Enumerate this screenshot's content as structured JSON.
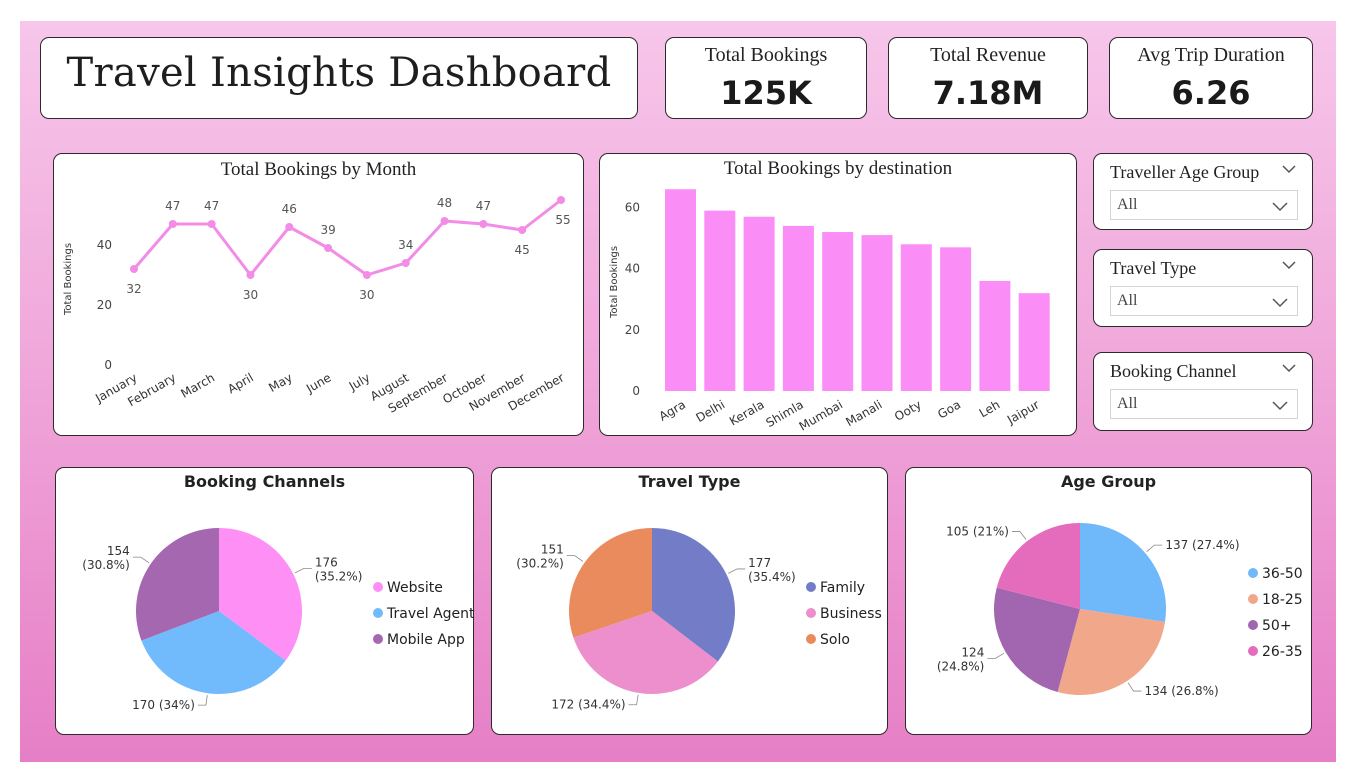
{
  "header": {
    "title": "Travel Insights Dashboard"
  },
  "kpis": [
    {
      "label": "Total Bookings",
      "value": "125K"
    },
    {
      "label": "Total Revenue",
      "value": "7.18M"
    },
    {
      "label": "Avg Trip Duration",
      "value": "6.26"
    }
  ],
  "slicers": [
    {
      "label": "Traveller Age Group",
      "value": "All"
    },
    {
      "label": "Travel Type",
      "value": "All"
    },
    {
      "label": "Booking Channel",
      "value": "All"
    }
  ],
  "chart_data": [
    {
      "type": "line",
      "title": "Total Bookings by Month",
      "ylabel": "Total Bookings",
      "xlabel": "",
      "categories": [
        "January",
        "February",
        "March",
        "April",
        "May",
        "June",
        "July",
        "August",
        "September",
        "October",
        "November",
        "December"
      ],
      "values": [
        32,
        47,
        47,
        30,
        46,
        39,
        30,
        34,
        48,
        47,
        45,
        55
      ],
      "y_ticks": [
        "0",
        "20",
        "40"
      ],
      "ylim": [
        0,
        60
      ],
      "color": "#f28ce6",
      "grid": false
    },
    {
      "type": "bar",
      "title": "Total Bookings by destination",
      "ylabel": "Total Bookings",
      "xlabel": "",
      "categories": [
        "Agra",
        "Delhi",
        "Kerala",
        "Shimla",
        "Mumbai",
        "Manali",
        "Ooty",
        "Goa",
        "Leh",
        "Jaipur"
      ],
      "values": [
        66,
        59,
        57,
        54,
        52,
        51,
        48,
        47,
        36,
        32
      ],
      "y_ticks": [
        "0",
        "20",
        "40",
        "60"
      ],
      "ylim": [
        0,
        70
      ],
      "color": "#fb8ef6",
      "grid": false
    },
    {
      "type": "pie",
      "title": "Booking Channels",
      "slices": [
        {
          "name": "Website",
          "value": 176,
          "label": "176",
          "pct": "(35.2%)",
          "color": "#fd8ff5"
        },
        {
          "name": "Travel Agent",
          "value": 170,
          "label": "170 (34%)",
          "pct": "",
          "color": "#71bbfd"
        },
        {
          "name": "Mobile App",
          "value": 154,
          "label": "154",
          "pct": "(30.8%)",
          "color": "#a667b1"
        }
      ],
      "legend": "right"
    },
    {
      "type": "pie",
      "title": "Travel Type",
      "slices": [
        {
          "name": "Family",
          "value": 177,
          "label": "177",
          "pct": "(35.4%)",
          "color": "#737cc6"
        },
        {
          "name": "Business",
          "value": 172,
          "label": "172 (34.4%)",
          "pct": "",
          "color": "#ec8fcc"
        },
        {
          "name": "Solo",
          "value": 151,
          "label": "151",
          "pct": "(30.2%)",
          "color": "#ea8b5e"
        }
      ],
      "legend": "right"
    },
    {
      "type": "pie",
      "title": "Age Group",
      "slices": [
        {
          "name": "36-50",
          "value": 137,
          "label": "137 (27.4%)",
          "pct": "",
          "color": "#6fb9fb"
        },
        {
          "name": "18-25",
          "value": 134,
          "label": "134 (26.8%)",
          "pct": "",
          "color": "#f0a78a"
        },
        {
          "name": "50+",
          "value": 124,
          "label": "124",
          "pct": "(24.8%)",
          "color": "#a266b0"
        },
        {
          "name": "26-35",
          "value": 105,
          "label": "105 (21%)",
          "pct": "",
          "color": "#e56bbc"
        }
      ],
      "legend": "right"
    }
  ]
}
